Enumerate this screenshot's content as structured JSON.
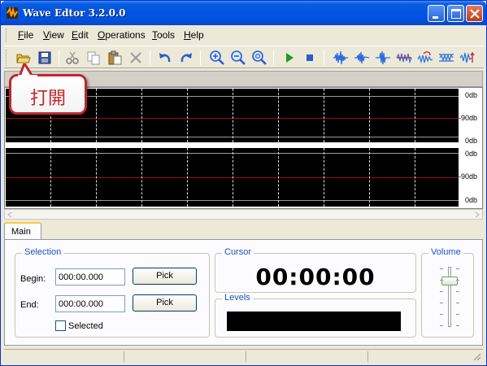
{
  "window": {
    "title": "Wave Edtor 3.2.0.0"
  },
  "menu": [
    "File",
    "View",
    "Edit",
    "Operations",
    "Tools",
    "Help"
  ],
  "toolbar": {
    "buttons": [
      "open-folder-icon",
      "save-icon",
      "cut-icon",
      "copy-icon",
      "paste-icon",
      "delete-icon",
      "undo-icon",
      "redo-icon",
      "zoom-in-icon",
      "zoom-out-icon",
      "zoom-fit-icon",
      "play-icon",
      "stop-icon",
      "wave-effect-1-icon",
      "wave-effect-2-icon",
      "wave-effect-3-icon",
      "wave-effect-4-icon",
      "wave-effect-5-icon",
      "wave-effect-6-icon",
      "wave-effect-7-icon",
      "wave-effect-8-icon"
    ]
  },
  "callout": {
    "text": "打開"
  },
  "waveform": {
    "channel1_labels": [
      "0db",
      "-90db",
      "0db"
    ],
    "channel2_labels": [
      "0db",
      "-90db",
      "0db"
    ]
  },
  "tabs": [
    "Main"
  ],
  "selection": {
    "title": "Selection",
    "begin_label": "Begin:",
    "begin_value": "000:00.000",
    "end_label": "End:",
    "end_value": "000:00.000",
    "pick_label": "Pick",
    "selected_label": "Selected",
    "selected_checked": false
  },
  "cursor": {
    "title": "Cursor",
    "time": "00:00:00"
  },
  "levels": {
    "title": "Levels"
  },
  "volume": {
    "title": "Volume",
    "level": 0.8
  },
  "colors": {
    "title_bar": "#0054e3",
    "accent_blue": "#1f4fc6",
    "callout_red": "#c0272d",
    "wave_background": "#000000"
  }
}
